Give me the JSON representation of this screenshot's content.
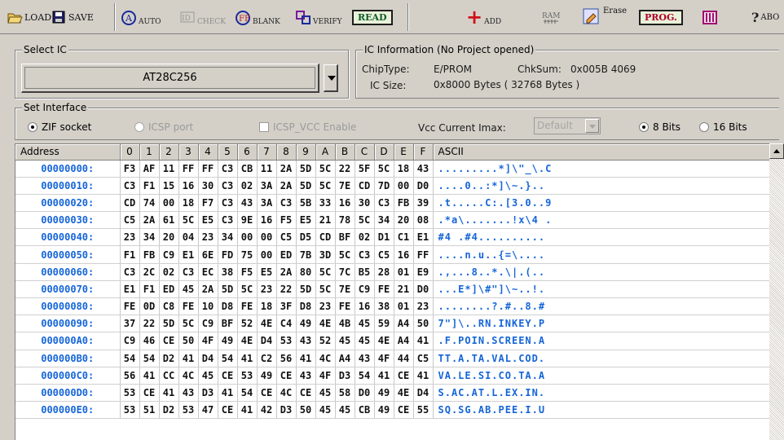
{
  "toolbar": {
    "load": "LOAD",
    "save": "SAVE",
    "auto": "AUTO",
    "check": "CHECK",
    "blank": "BLANK",
    "verify": "VERIFY",
    "read": "READ",
    "add": "ADD",
    "ram": "RAM",
    "erase": "Erase",
    "prog": "PROG.",
    "about": "ABO"
  },
  "select_ic": {
    "title": "Select IC",
    "value": "AT28C256"
  },
  "ic_info": {
    "title": "IC Information (No Project opened)",
    "chip_type_label": "ChipType:",
    "chip_type": "E/PROM",
    "chksum_label": "ChkSum:",
    "chksum": "0x005B 4069",
    "size_label": "IC Size:",
    "size": "0x8000 Bytes ( 32768 Bytes )"
  },
  "interface": {
    "title": "Set Interface",
    "zif": "ZIF socket",
    "icsp": "ICSP port",
    "icsp_vcc": "ICSP_VCC Enable",
    "vcc_label": "Vcc Current Imax:",
    "vcc_value": "Default",
    "bits8": "8 Bits",
    "bits16": "16 Bits"
  },
  "grid": {
    "headers": [
      "Address",
      "0",
      "1",
      "2",
      "3",
      "4",
      "5",
      "6",
      "7",
      "8",
      "9",
      "A",
      "B",
      "C",
      "D",
      "E",
      "F",
      "ASCII"
    ],
    "rows": [
      {
        "addr": "00000000:",
        "bytes": [
          "F3",
          "AF",
          "11",
          "FF",
          "FF",
          "C3",
          "CB",
          "11",
          "2A",
          "5D",
          "5C",
          "22",
          "5F",
          "5C",
          "18",
          "43"
        ],
        "ascii": ".........*]\\\"_\\.C"
      },
      {
        "addr": "00000010:",
        "bytes": [
          "C3",
          "F1",
          "15",
          "16",
          "30",
          "C3",
          "02",
          "3A",
          "2A",
          "5D",
          "5C",
          "7E",
          "CD",
          "7D",
          "00",
          "D0"
        ],
        "ascii": "....0..:*]\\~.}.."
      },
      {
        "addr": "00000020:",
        "bytes": [
          "CD",
          "74",
          "00",
          "18",
          "F7",
          "C3",
          "43",
          "3A",
          "C3",
          "5B",
          "33",
          "16",
          "30",
          "C3",
          "FB",
          "39"
        ],
        "ascii": ".t.....C:.[3.0..9"
      },
      {
        "addr": "00000030:",
        "bytes": [
          "C5",
          "2A",
          "61",
          "5C",
          "E5",
          "C3",
          "9E",
          "16",
          "F5",
          "E5",
          "21",
          "78",
          "5C",
          "34",
          "20",
          "08"
        ],
        "ascii": ".*a\\.......!x\\4 ."
      },
      {
        "addr": "00000040:",
        "bytes": [
          "23",
          "34",
          "20",
          "04",
          "23",
          "34",
          "00",
          "00",
          "C5",
          "D5",
          "CD",
          "BF",
          "02",
          "D1",
          "C1",
          "E1"
        ],
        "ascii": "#4 .#4.........."
      },
      {
        "addr": "00000050:",
        "bytes": [
          "F1",
          "FB",
          "C9",
          "E1",
          "6E",
          "FD",
          "75",
          "00",
          "ED",
          "7B",
          "3D",
          "5C",
          "C3",
          "C5",
          "16",
          "FF"
        ],
        "ascii": "....n.u..{=\\...."
      },
      {
        "addr": "00000060:",
        "bytes": [
          "C3",
          "2C",
          "02",
          "C3",
          "EC",
          "38",
          "F5",
          "E5",
          "2A",
          "80",
          "5C",
          "7C",
          "B5",
          "28",
          "01",
          "E9"
        ],
        "ascii": ".,...8..*.\\|.(.."
      },
      {
        "addr": "00000070:",
        "bytes": [
          "E1",
          "F1",
          "ED",
          "45",
          "2A",
          "5D",
          "5C",
          "23",
          "22",
          "5D",
          "5C",
          "7E",
          "C9",
          "FE",
          "21",
          "D0"
        ],
        "ascii": "...E*]\\#\"]\\~..!."
      },
      {
        "addr": "00000080:",
        "bytes": [
          "FE",
          "0D",
          "C8",
          "FE",
          "10",
          "D8",
          "FE",
          "18",
          "3F",
          "D8",
          "23",
          "FE",
          "16",
          "38",
          "01",
          "23"
        ],
        "ascii": "........?.#..8.#"
      },
      {
        "addr": "00000090:",
        "bytes": [
          "37",
          "22",
          "5D",
          "5C",
          "C9",
          "BF",
          "52",
          "4E",
          "C4",
          "49",
          "4E",
          "4B",
          "45",
          "59",
          "A4",
          "50"
        ],
        "ascii": "7\"]\\..RN.INKEY.P"
      },
      {
        "addr": "000000A0:",
        "bytes": [
          "C9",
          "46",
          "CE",
          "50",
          "4F",
          "49",
          "4E",
          "D4",
          "53",
          "43",
          "52",
          "45",
          "45",
          "4E",
          "A4",
          "41"
        ],
        "ascii": ".F.POIN.SCREEN.A"
      },
      {
        "addr": "000000B0:",
        "bytes": [
          "54",
          "54",
          "D2",
          "41",
          "D4",
          "54",
          "41",
          "C2",
          "56",
          "41",
          "4C",
          "A4",
          "43",
          "4F",
          "44",
          "C5"
        ],
        "ascii": "TT.A.TA.VAL.COD."
      },
      {
        "addr": "000000C0:",
        "bytes": [
          "56",
          "41",
          "CC",
          "4C",
          "45",
          "CE",
          "53",
          "49",
          "CE",
          "43",
          "4F",
          "D3",
          "54",
          "41",
          "CE",
          "41"
        ],
        "ascii": "VA.LE.SI.CO.TA.A"
      },
      {
        "addr": "000000D0:",
        "bytes": [
          "53",
          "CE",
          "41",
          "43",
          "D3",
          "41",
          "54",
          "CE",
          "4C",
          "CE",
          "45",
          "58",
          "D0",
          "49",
          "4E",
          "D4"
        ],
        "ascii": "S.AC.AT.L.EX.IN."
      },
      {
        "addr": "000000E0:",
        "bytes": [
          "53",
          "51",
          "D2",
          "53",
          "47",
          "CE",
          "41",
          "42",
          "D3",
          "50",
          "45",
          "45",
          "CB",
          "49",
          "CE",
          "55"
        ],
        "ascii": "SQ.SG.AB.PEE.I.U"
      }
    ]
  }
}
